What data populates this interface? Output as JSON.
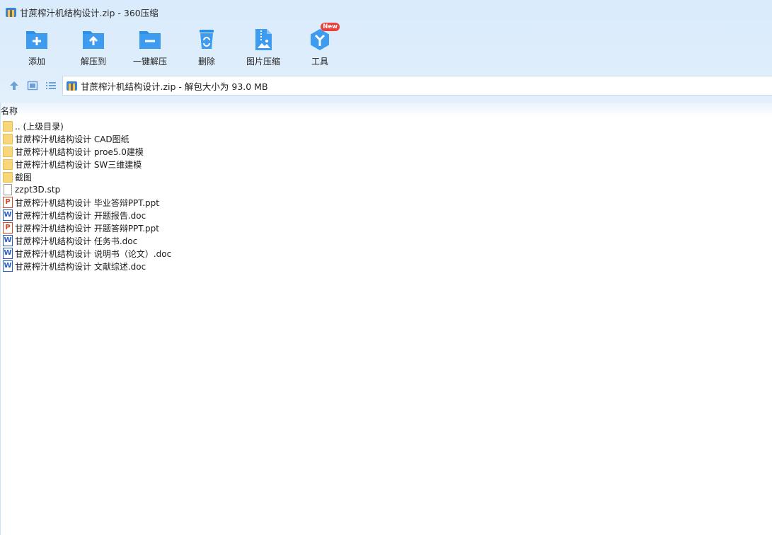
{
  "window": {
    "title": "甘蔗榨汁机结构设计.zip - 360压缩"
  },
  "toolbar": {
    "items": [
      {
        "label": "添加",
        "icon": "add-folder-icon"
      },
      {
        "label": "解压到",
        "icon": "extract-to-icon"
      },
      {
        "label": "一键解压",
        "icon": "one-click-extract-icon"
      },
      {
        "label": "删除",
        "icon": "trash-icon"
      },
      {
        "label": "图片压缩",
        "icon": "image-compress-icon"
      },
      {
        "label": "工具",
        "icon": "tools-icon",
        "badge": "New"
      }
    ]
  },
  "address": {
    "text": "甘蔗榨汁机结构设计.zip - 解包大小为 93.0 MB"
  },
  "list": {
    "column_name": "名称",
    "items": [
      {
        "name": ".. (上级目录)",
        "type": "folder"
      },
      {
        "name": "甘蔗榨汁机结构设计 CAD图纸",
        "type": "folder"
      },
      {
        "name": "甘蔗榨汁机结构设计 proe5.0建模",
        "type": "folder"
      },
      {
        "name": "甘蔗榨汁机结构设计 SW三维建模",
        "type": "folder"
      },
      {
        "name": "截图",
        "type": "folder"
      },
      {
        "name": "zzpt3D.stp",
        "type": "file"
      },
      {
        "name": "甘蔗榨汁机结构设计 毕业答辩PPT.ppt",
        "type": "ppt"
      },
      {
        "name": "甘蔗榨汁机结构设计 开题报告.doc",
        "type": "doc"
      },
      {
        "name": "甘蔗榨汁机结构设计 开题答辩PPT.ppt",
        "type": "ppt"
      },
      {
        "name": "甘蔗榨汁机结构设计 任务书.doc",
        "type": "doc"
      },
      {
        "name": "甘蔗榨汁机结构设计 说明书（论文）.doc",
        "type": "doc"
      },
      {
        "name": "甘蔗榨汁机结构设计 文献综述.doc",
        "type": "doc"
      }
    ]
  },
  "colors": {
    "accent": "#2e8fe6",
    "toolbar_bg": "#dcecfb",
    "badge": "#e8413c"
  }
}
